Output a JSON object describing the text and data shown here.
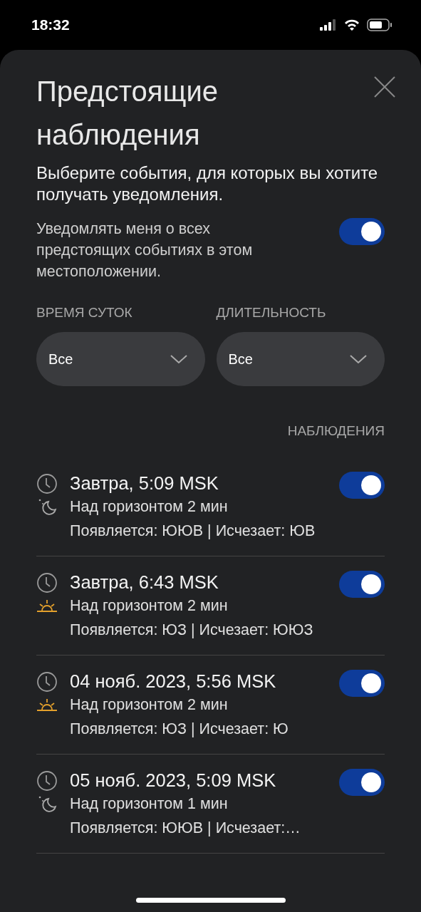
{
  "status_bar": {
    "time": "18:32"
  },
  "sheet": {
    "title": "Предстоящие наблюдения",
    "subtitle": "Выберите события, для которых вы хотите получать уведомления.",
    "notify_all": {
      "label": "Уведомлять меня о всех предстоящих событиях в этом местоположении.",
      "on": true
    }
  },
  "filters": [
    {
      "label": "ВРЕМЯ СУТОК",
      "value": "Все"
    },
    {
      "label": "ДЛИТЕЛЬНОСТЬ",
      "value": "Все"
    }
  ],
  "section_label": "НАБЛЮДЕНИЯ",
  "events": [
    {
      "kind": "night",
      "title": "Завтра, 5:09 MSK",
      "duration": "Над горизонтом 2 мин",
      "directions": "Появляется: ЮЮВ | Исчезает: ЮВ",
      "on": true
    },
    {
      "kind": "twilight",
      "title": "Завтра, 6:43 MSK",
      "duration": "Над горизонтом 2 мин",
      "directions": "Появляется: ЮЗ | Исчезает: ЮЮЗ",
      "on": true
    },
    {
      "kind": "twilight",
      "title": "04 нояб. 2023, 5:56 MSK",
      "duration": "Над горизонтом 2 мин",
      "directions": "Появляется: ЮЗ | Исчезает: Ю",
      "on": true
    },
    {
      "kind": "night",
      "title": "05 нояб. 2023, 5:09 MSK",
      "duration": "Над горизонтом 1 мин",
      "directions": "Появляется: ЮЮВ | Исчезает:…",
      "on": true
    }
  ]
}
